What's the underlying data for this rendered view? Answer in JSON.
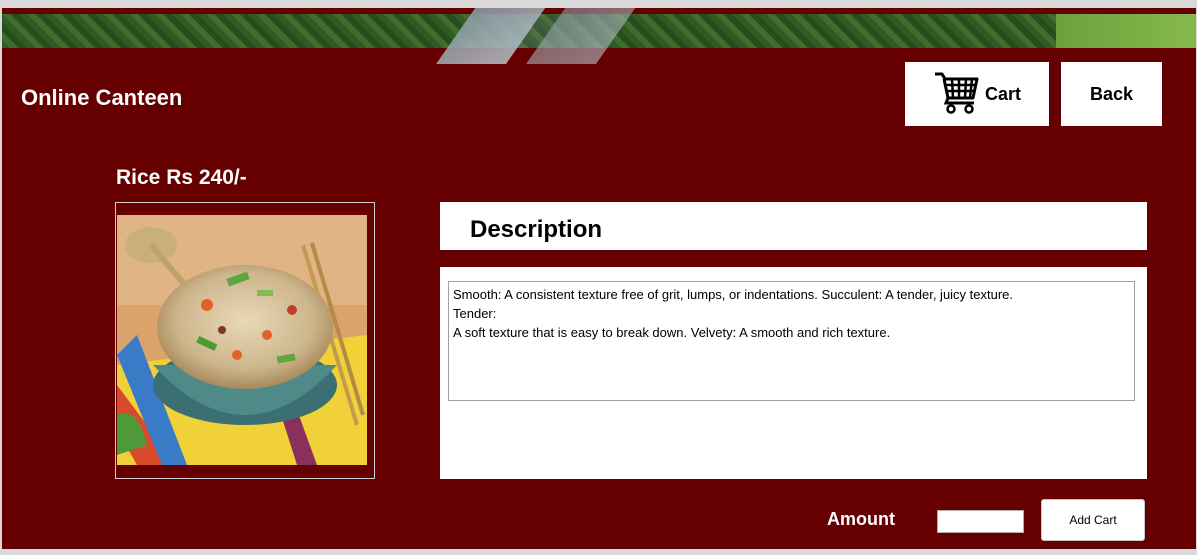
{
  "app": {
    "title": "Online Canteen"
  },
  "header": {
    "cart_label": "Cart",
    "back_label": "Back"
  },
  "product": {
    "title": "Rice Rs 240/-"
  },
  "description": {
    "heading": "Description",
    "lines": [
      "Smooth: A consistent texture free of grit, lumps, or indentations. Succulent: A tender, juicy texture.",
      "Tender:",
      "A soft texture that is easy to break down. Velvety: A smooth and rich texture."
    ]
  },
  "order": {
    "amount_label": "Amount",
    "amount_value": "",
    "add_cart_label": "Add Cart"
  },
  "colors": {
    "background": "#660000",
    "panel": "#ffffff",
    "text_light": "#ffffff"
  }
}
